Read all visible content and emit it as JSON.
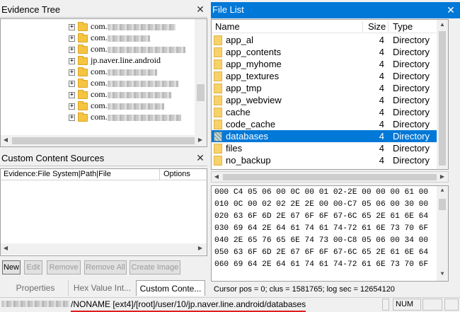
{
  "evidence_tree": {
    "title": "Evidence Tree",
    "items": [
      {
        "label": "com."
      },
      {
        "label": "com."
      },
      {
        "label": "com."
      },
      {
        "label": "jp.naver.line.android"
      },
      {
        "label": "com."
      },
      {
        "label": "com."
      },
      {
        "label": "com."
      },
      {
        "label": "com."
      },
      {
        "label": "com."
      }
    ]
  },
  "custom_content": {
    "title": "Custom Content Sources",
    "columns": [
      "Evidence:File System|Path|File",
      "Options"
    ],
    "buttons": [
      "New",
      "Edit",
      "Remove",
      "Remove All",
      "Create Image"
    ]
  },
  "bottom_tabs": [
    "Properties",
    "Hex Value Int...",
    "Custom Conte..."
  ],
  "file_list": {
    "title": "File List",
    "columns": [
      "Name",
      "Size",
      "Type"
    ],
    "rows": [
      {
        "name": "app_al",
        "size": "4",
        "type": "Directory"
      },
      {
        "name": "app_contents",
        "size": "4",
        "type": "Directory"
      },
      {
        "name": "app_myhome",
        "size": "4",
        "type": "Directory"
      },
      {
        "name": "app_textures",
        "size": "4",
        "type": "Directory"
      },
      {
        "name": "app_tmp",
        "size": "4",
        "type": "Directory"
      },
      {
        "name": "app_webview",
        "size": "4",
        "type": "Directory"
      },
      {
        "name": "cache",
        "size": "4",
        "type": "Directory"
      },
      {
        "name": "code_cache",
        "size": "4",
        "type": "Directory"
      },
      {
        "name": "databases",
        "size": "4",
        "type": "Directory",
        "selected": true
      },
      {
        "name": "files",
        "size": "4",
        "type": "Directory"
      },
      {
        "name": "no_backup",
        "size": "4",
        "type": "Directory"
      }
    ]
  },
  "hex_view": {
    "rows": [
      "000 C4 05 06 00 0C 00 01 02-2E 00 00 00 61 00",
      "010 0C 00 02 02 2E 2E 00 00-C7 05 06 00 30 00",
      "020 63 6F 6D 2E 67 6F 6F 67-6C 65 2E 61 6E 64",
      "030 69 64 2E 64 61 74 61 74-72 61 6E 73 70 6F",
      "040 2E 65 76 65 6E 74 73 00-C8 05 06 00 34 00",
      "050 63 6F 6D 2E 67 6F 6F 67-6C 65 2E 61 6E 64",
      "060 69 64 2E 64 61 74 61 74-72 61 6E 73 70 6F"
    ]
  },
  "status_line": "Cursor pos = 0; clus = 1581765; log sec = 12654120",
  "status_bar": {
    "path": "/NONAME [ext4]/[root]/user/10/jp.naver.line.android/databases",
    "num": "NUM"
  },
  "colors": {
    "accent": "#0078d7",
    "path_underline": "#e02020"
  }
}
